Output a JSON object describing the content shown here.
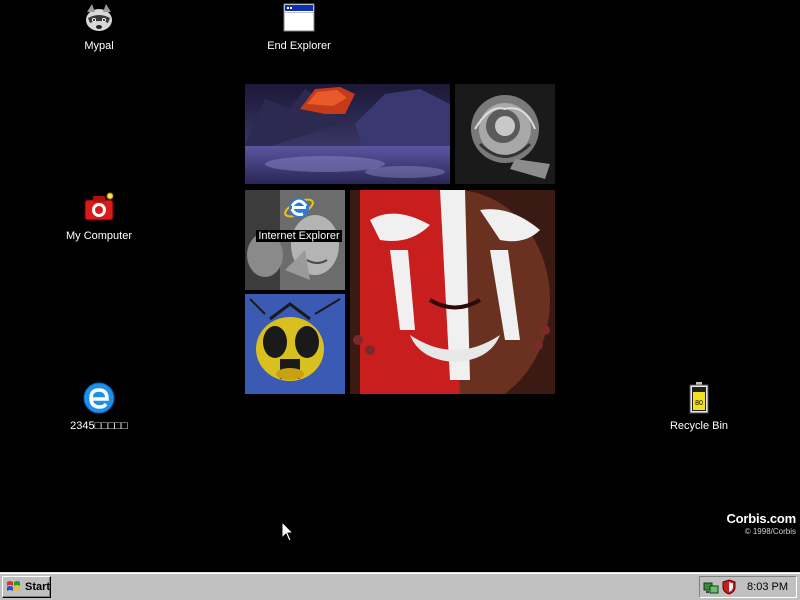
{
  "desktop": {
    "icons": [
      {
        "label": "Mypal",
        "icon": "raccoon-icon"
      },
      {
        "label": "End Explorer",
        "icon": "window-icon"
      },
      {
        "label": "My Computer",
        "icon": "camera-icon"
      },
      {
        "label": "Internet Explorer",
        "icon": "internet-explorer-icon"
      },
      {
        "label": "2345□□□□□",
        "icon": "browser-e-icon"
      },
      {
        "label": "Recycle Bin",
        "icon": "battery-icon"
      }
    ]
  },
  "wallpaper": {
    "brand": "Corbis.com",
    "copyright": "© 1998/Corbis"
  },
  "taskbar": {
    "start_label": "Start",
    "clock": "8:03 PM",
    "tray_icons": [
      "network-icon",
      "shield-icon"
    ]
  },
  "colors": {
    "desktop_bg": "#000000",
    "taskbar_bg": "#c0c0c0",
    "ie_blue": "#1e7fd8"
  }
}
